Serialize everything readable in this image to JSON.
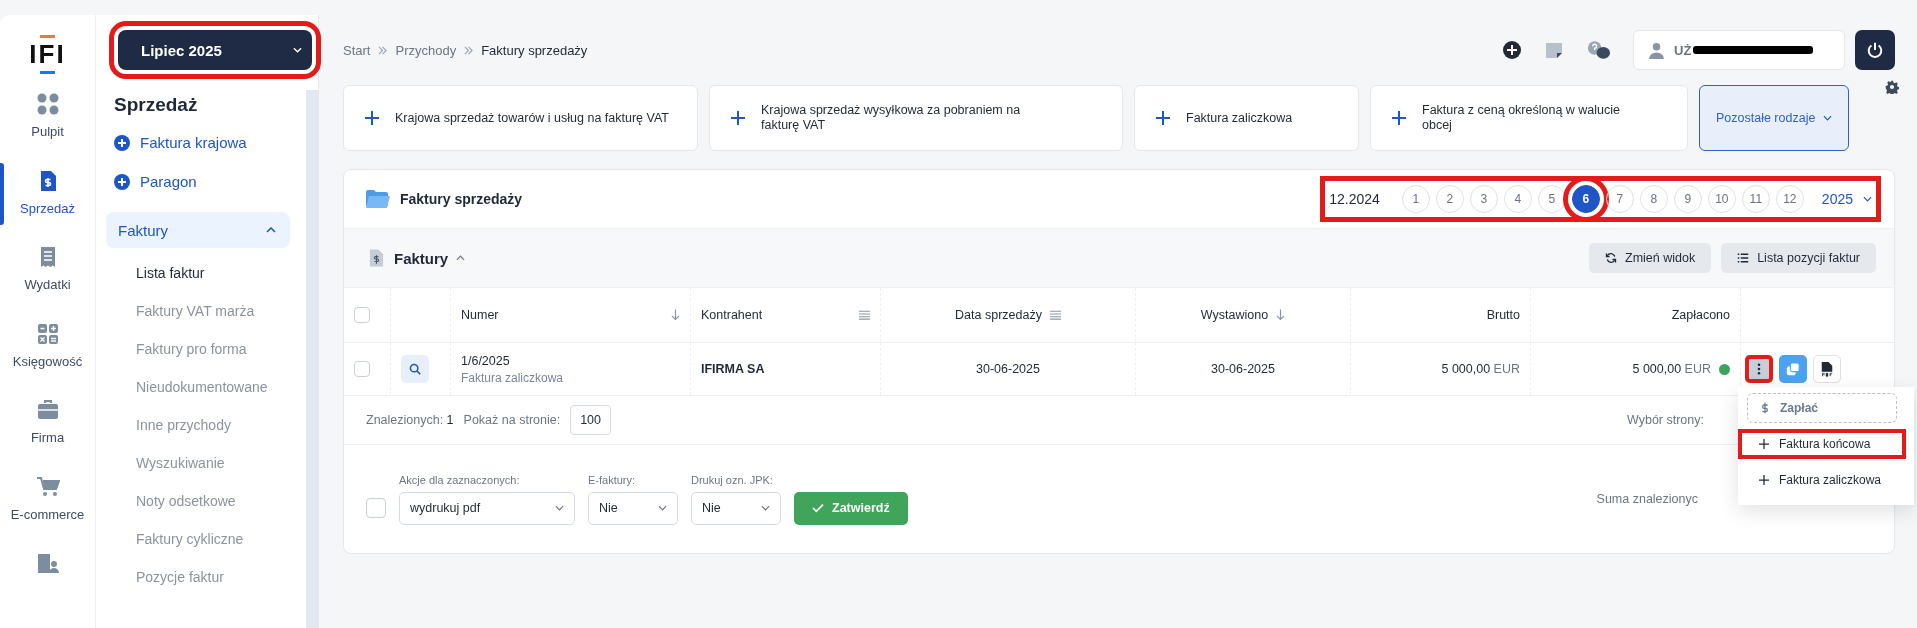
{
  "logo": "IFI",
  "period": {
    "label": "Lipiec 2025",
    "highlighted": true
  },
  "rail": [
    {
      "label": "Pulpit",
      "kind": "dots",
      "selected": false
    },
    {
      "label": "Sprzedaż",
      "kind": "invoice",
      "selected": true
    },
    {
      "label": "Wydatki",
      "kind": "receipt",
      "selected": false
    },
    {
      "label": "Księgowość",
      "kind": "calc",
      "selected": false
    },
    {
      "label": "Firma",
      "kind": "case",
      "selected": false
    },
    {
      "label": "E-commerce",
      "kind": "cart",
      "selected": false
    },
    {
      "kind": "building",
      "selected": false
    }
  ],
  "sidebar": {
    "title": "Sprzedaż",
    "actions": [
      "Faktura krajowa",
      "Paragon"
    ],
    "group": {
      "label": "Faktury",
      "expanded": true,
      "items": [
        {
          "label": "Lista faktur",
          "selected": true
        },
        {
          "label": "Faktury VAT marża",
          "selected": false
        },
        {
          "label": "Faktury pro forma",
          "selected": false
        },
        {
          "label": "Nieudokumentowane",
          "selected": false
        },
        {
          "label": "Inne przychody",
          "selected": false
        },
        {
          "label": "Wyszukiwanie",
          "selected": false
        },
        {
          "label": "Noty odsetkowe",
          "selected": false
        },
        {
          "label": "Faktury cykliczne",
          "selected": false
        },
        {
          "label": "Pozycje faktur",
          "selected": false
        }
      ]
    }
  },
  "breadcrumb": [
    "Start",
    "Przychody",
    "Faktury sprzedaży"
  ],
  "user": {
    "name": "UŻ"
  },
  "quick_actions": [
    "Krajowa sprzedaż towarów i usług na fakturę VAT",
    "Krajowa sprzedaż wysyłkowa za pobraniem na fakturę VAT",
    "Faktura zaliczkowa",
    "Faktura z ceną określoną w walucie obcej"
  ],
  "more_types": "Pozostałe rodzaje",
  "panel": {
    "title": "Faktury sprzedaży",
    "months_highlighted": true,
    "previous": "12.2024",
    "months": [
      {
        "label": "1",
        "selected": false,
        "highlighted": false
      },
      {
        "label": "2",
        "selected": false,
        "highlighted": false
      },
      {
        "label": "3",
        "selected": false,
        "highlighted": false
      },
      {
        "label": "4",
        "selected": false,
        "highlighted": false
      },
      {
        "label": "5",
        "selected": false,
        "highlighted": false
      },
      {
        "label": "6",
        "selected": true,
        "highlighted": true
      },
      {
        "label": "7",
        "selected": false,
        "highlighted": false
      },
      {
        "label": "8",
        "selected": false,
        "highlighted": false
      },
      {
        "label": "9",
        "selected": false,
        "highlighted": false
      },
      {
        "label": "10",
        "selected": false,
        "highlighted": false
      },
      {
        "label": "11",
        "selected": false,
        "highlighted": false
      },
      {
        "label": "12",
        "selected": false,
        "highlighted": false
      }
    ],
    "year": "2025"
  },
  "section": {
    "title": "Faktury",
    "expanded": true,
    "buttons": [
      {
        "label": "Zmień widok",
        "kind": "refresh"
      },
      {
        "label": "Lista pozycji faktur",
        "kind": "list"
      }
    ]
  },
  "table": {
    "select_all": {
      "checked": false
    },
    "columns": [
      {
        "label": "Numer",
        "kind": "sort"
      },
      {
        "label": "Kontrahent",
        "kind": "filter"
      },
      {
        "label": "Data sprzedaży",
        "kind": "filter"
      },
      {
        "label": "Wystawiono",
        "kind": "sort"
      },
      {
        "label": "Brutto",
        "kind": "plain"
      },
      {
        "label": "Zapłacono",
        "kind": "plain"
      }
    ],
    "rows": [
      {
        "checked": false,
        "number": "1/6/2025",
        "type": "Faktura zaliczkowa",
        "contractor": "IFIRMA SA",
        "sale_date": "30-06-2025",
        "issued": "30-06-2025",
        "gross": "5 000,00",
        "gross_currency": "EUR",
        "paid": "5 000,00",
        "paid_currency": "EUR",
        "color": "#3da35d",
        "menu_highlighted": true
      }
    ]
  },
  "footer": {
    "found_label": "Znalezionych:",
    "found": "1",
    "per_page_label": "Pokaż na stronie:",
    "per_page": "100",
    "page_label": "Wybór strony:"
  },
  "bulk": {
    "checked": false,
    "fields": [
      {
        "label": "Akcje dla zaznaczonych:",
        "value": "wydrukuj pdf"
      },
      {
        "label": "E-faktury:",
        "value": "Nie"
      },
      {
        "label": "Drukuj ozn. JPK:",
        "value": "Nie"
      }
    ],
    "submit": "Zatwierdź",
    "sum_label": "Suma znalezionyc"
  },
  "menu": [
    {
      "kind": "pay",
      "label": "Zapłać",
      "highlighted": false
    },
    {
      "kind": "add",
      "label": "Faktura końcowa",
      "highlighted": true
    },
    {
      "kind": "add",
      "label": "Faktura zaliczkowa",
      "highlighted": false
    }
  ]
}
